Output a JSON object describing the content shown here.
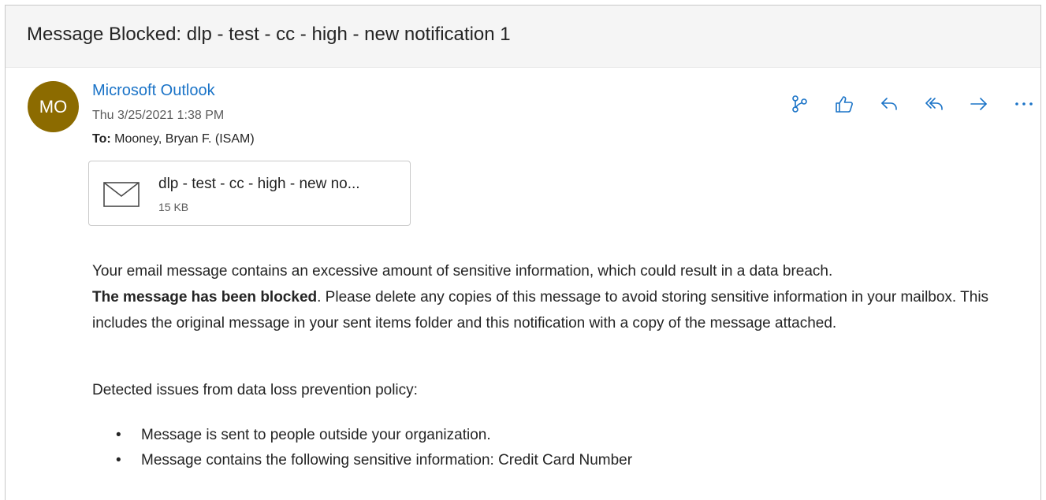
{
  "message": {
    "subject": "Message Blocked: dlp - test - cc - high - new notification 1",
    "avatar_initials": "MO",
    "avatar_color": "#8c6b00",
    "sender_name": "Microsoft Outlook",
    "sent_date": "Thu 3/25/2021 1:38 PM",
    "to_label": "To:",
    "to_value": "Mooney, Bryan F. (ISAM)"
  },
  "actions": [
    {
      "name": "loop-icon"
    },
    {
      "name": "like-icon"
    },
    {
      "name": "reply-icon"
    },
    {
      "name": "reply-all-icon"
    },
    {
      "name": "forward-icon"
    },
    {
      "name": "more-icon"
    }
  ],
  "attachment": {
    "icon": "envelope-icon",
    "name": "dlp - test - cc - high - new no...",
    "size": "15 KB"
  },
  "body": {
    "intro": "Your email message contains an excessive amount of sensitive information, which could result in a data breach.",
    "blocked_bold": "The message has been blocked",
    "instructions": ". Please delete any copies of this message to avoid storing sensitive information in your mailbox. This includes the original message in your sent items folder and this notification with a copy of the message attached.",
    "issues_heading": "Detected issues from data loss prevention policy:",
    "issues": [
      "Message is sent to people outside your organization.",
      "Message contains the following sensitive information: Credit Card Number"
    ]
  },
  "colors": {
    "accent": "#1a73c7",
    "subject_bar": "#f5f5f5"
  }
}
